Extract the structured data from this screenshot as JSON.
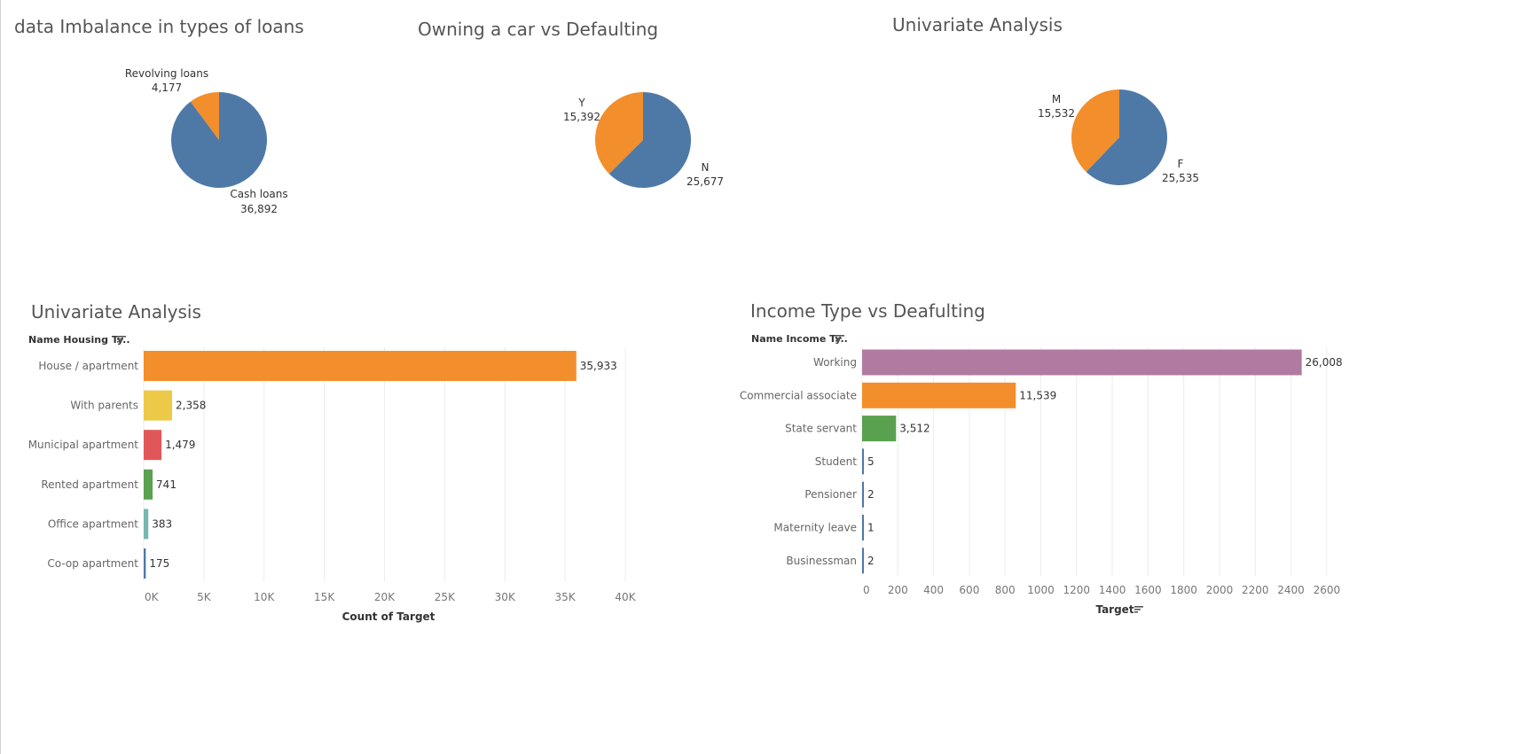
{
  "chart_data": [
    {
      "type": "pie",
      "title": "data Imbalance in types of loans",
      "slices": [
        {
          "label": "Cash loans",
          "value": 36892,
          "display": "36,892",
          "color": "#4e79a7"
        },
        {
          "label": "Revolving loans",
          "value": 4177,
          "display": "4,177",
          "color": "#f28e2b"
        }
      ]
    },
    {
      "type": "pie",
      "title": "Owning a car vs Defaulting",
      "slices": [
        {
          "label": "N",
          "value": 25677,
          "display": "25,677",
          "color": "#4e79a7"
        },
        {
          "label": "Y",
          "value": 15392,
          "display": "15,392",
          "color": "#f28e2b"
        }
      ]
    },
    {
      "type": "pie",
      "title": "Univariate Analysis",
      "slices": [
        {
          "label": "F",
          "value": 25535,
          "display": "25,535",
          "color": "#4e79a7"
        },
        {
          "label": "M",
          "value": 15532,
          "display": "15,532",
          "color": "#f28e2b"
        }
      ]
    },
    {
      "type": "bar",
      "orientation": "horizontal",
      "title": "Univariate Analysis",
      "ylabel": "Name Housing Ty..",
      "xlabel": "Count of Target",
      "categories": [
        "House / apartment",
        "With parents",
        "Municipal apartment",
        "Rented apartment",
        "Office apartment",
        "Co-op apartment"
      ],
      "values": [
        35933,
        2358,
        1479,
        741,
        383,
        175
      ],
      "value_labels": [
        "35,933",
        "2,358",
        "1,479",
        "741",
        "383",
        "175"
      ],
      "colors": [
        "#f28e2b",
        "#edc948",
        "#e15759",
        "#59a14f",
        "#76b7b2",
        "#4e79a7"
      ],
      "xlim": [
        0,
        40000
      ],
      "ticks": [
        0,
        5000,
        10000,
        15000,
        20000,
        25000,
        30000,
        35000,
        40000
      ],
      "tick_labels": [
        "0K",
        "5K",
        "10K",
        "15K",
        "20K",
        "25K",
        "30K",
        "35K",
        "40K"
      ]
    },
    {
      "type": "bar",
      "orientation": "horizontal",
      "title": "Income Type vs Deafulting",
      "ylabel": "Name Income Ty..",
      "xlabel": "Target",
      "categories": [
        "Working",
        "Commercial associate",
        "State servant",
        "Student",
        "Pensioner",
        "Maternity leave",
        "Businessman"
      ],
      "values": [
        2460,
        860,
        190,
        0,
        0,
        0,
        0
      ],
      "value_labels": [
        "26,008",
        "11,539",
        "3,512",
        "5",
        "2",
        "1",
        "2"
      ],
      "colors": [
        "#b07aa1",
        "#f28e2b",
        "#59a14f",
        "#4e79a7",
        "#4e79a7",
        "#4e79a7",
        "#4e79a7"
      ],
      "xlim": [
        0,
        2700
      ],
      "ticks": [
        0,
        200,
        400,
        600,
        800,
        1000,
        1200,
        1400,
        1600,
        1800,
        2000,
        2200,
        2400,
        2600
      ],
      "tick_labels": [
        "0",
        "200",
        "400",
        "600",
        "800",
        "1000",
        "1200",
        "1400",
        "1600",
        "1800",
        "2000",
        "2200",
        "2400",
        "2600"
      ]
    }
  ]
}
